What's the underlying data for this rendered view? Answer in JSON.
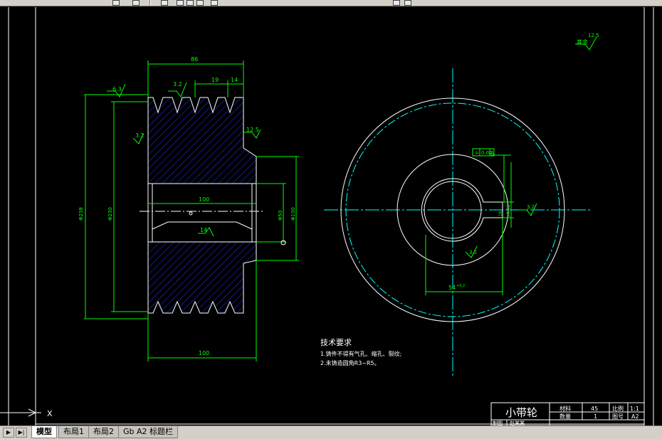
{
  "tabs": {
    "model": "模型",
    "layout1": "布局1",
    "layout2": "布局2",
    "gb_a2": "Gb A2 标题栏"
  },
  "nav": {
    "first": "▶",
    "prev": "▶|"
  },
  "notes": {
    "heading": "技术要求",
    "line1": "1.铸件不得有气孔、缩孔、裂纹;",
    "line2": "2.未铸造圆角R3~R5。"
  },
  "dims": {
    "width_top": "86",
    "width_bottom": "100",
    "hub": "100",
    "pitch": "19",
    "groove": "14",
    "diam_outer": "Φ238",
    "diam_pitch": "Φ230",
    "bore": "Φ50",
    "hub_diam": "Φ100",
    "key_width": "54",
    "key_tol": "+0.2",
    "key_depth": "16",
    "key_depth_tol": "±0.02",
    "chamfer": "14"
  },
  "roughness": {
    "rest": "其余",
    "rest_val": "12.5",
    "r1": "6.3",
    "r2": "3.2",
    "r3": "3.2",
    "r4": "12.5",
    "r5": "3.2",
    "r6": "3.2"
  },
  "tolerance": {
    "symbol": "=",
    "value": "0.02",
    "datum": "A"
  },
  "title_block": {
    "part_name": "小带轮",
    "material_label": "材料",
    "material": "45",
    "scale_label": "比例",
    "scale": "1:1",
    "qty_label": "数量",
    "qty": "1",
    "drawing_no_label": "图号",
    "drawing_no": "A2",
    "drawn_label": "制图",
    "drawn_by": "赵某某"
  },
  "ucs": {
    "x": "X"
  },
  "colors": {
    "green": "#00ff00",
    "white": "#ffffff",
    "cyan": "#00ffff",
    "blue": "#2233ff"
  }
}
